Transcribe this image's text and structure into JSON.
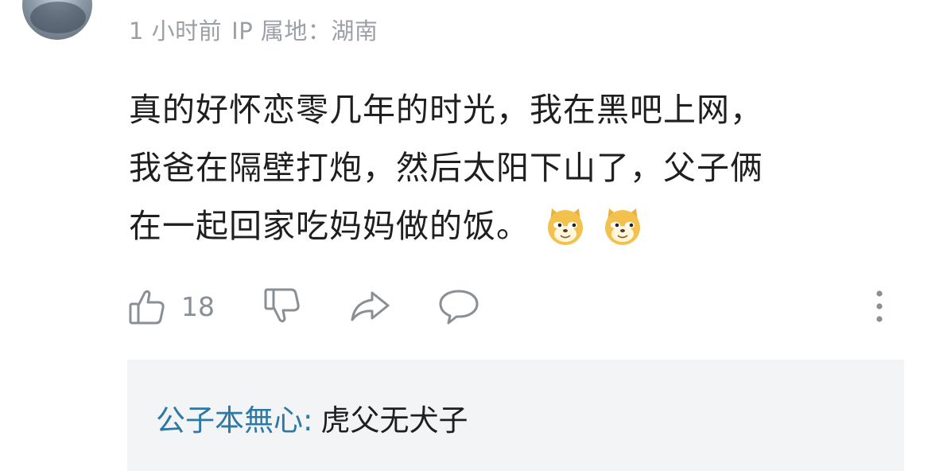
{
  "comment": {
    "meta": {
      "time": "1 小时前",
      "ip": "IP 属地：湖南"
    },
    "lines": [
      "真的好怀恋零几年的时光，我在黑吧上网，",
      "我爸在隔壁打炮，然后太阳下山了，父子俩",
      "在一起回家吃妈妈做的饭。"
    ],
    "emojis": [
      "doge-emoji",
      "doge-emoji"
    ],
    "actions": {
      "like_count": "18",
      "icons": [
        "thumbs-up-icon",
        "thumbs-down-icon",
        "share-icon",
        "comment-icon",
        "more-vertical-icon"
      ]
    }
  },
  "reply": {
    "user": "公子本無心",
    "separator": ":",
    "text": "虎父无犬子"
  },
  "colors": {
    "meta": "#9aa0a6",
    "text": "#1f1f1f",
    "reply_user": "#2e78a5",
    "reply_bg": "#f3f4f5",
    "icon": "#8a8f95"
  }
}
